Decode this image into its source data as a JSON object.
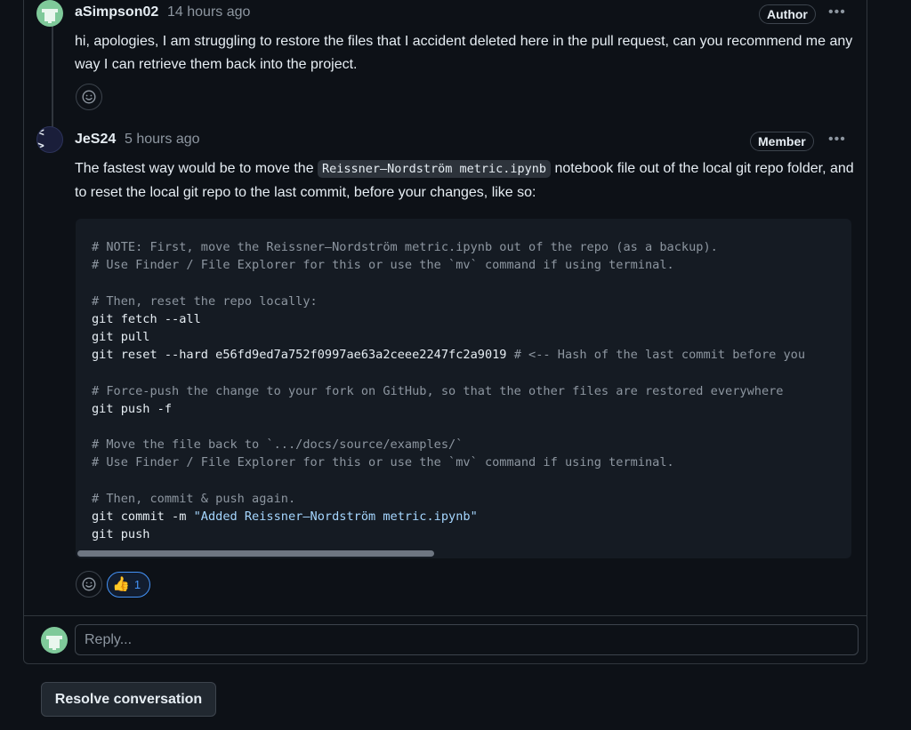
{
  "comments": [
    {
      "author": "aSimpson02",
      "time": "14 hours ago",
      "badge": "Author",
      "body": "hi, apologies, I am struggling to restore the files that I accident deleted here in the pull request, can you recommend me any way I can retrieve them back into the project."
    },
    {
      "author": "JeS24",
      "avatar_glyph": "< >",
      "time": "5 hours ago",
      "badge": "Member",
      "body_before": "The fastest way would be to move the ",
      "inline_code": "Reissner–Nordström metric.ipynb",
      "body_after": " notebook file out of the local git repo folder, and to reset the local git repo to the last commit, before your changes, like so:",
      "code": [
        "# NOTE: First, move the Reissner–Nordström metric.ipynb out of the repo (as a backup).",
        "# Use Finder / File Explorer for this or use the `mv` command if using terminal.",
        "",
        "# Then, reset the repo locally:",
        "git fetch --all",
        "git pull",
        "git reset --hard e56fd9ed7a752f0997ae63a2ceee2247fc2a9019",
        "# <-- Hash of the last commit before you",
        "",
        "# Force-push the change to your fork on GitHub, so that the other files are restored everywhere",
        "git push -f",
        "",
        "# Move the file back to `.../docs/source/examples/`",
        "# Use Finder / File Explorer for this or use the `mv` command if using terminal.",
        "",
        "# Then, commit & push again.",
        "git commit -m ",
        "\"Added Reissner–Nordström metric.ipynb\"",
        "git push"
      ],
      "reaction_count": "1"
    }
  ],
  "kebab_glyph": "•••",
  "reply_placeholder": "Reply...",
  "resolve_label": "Resolve conversation",
  "colors": {
    "background": "#0d1117",
    "border": "#30363d",
    "accent": "#4493f8",
    "comment_text": "#8d96a0",
    "string_text": "#a5d6ff"
  }
}
